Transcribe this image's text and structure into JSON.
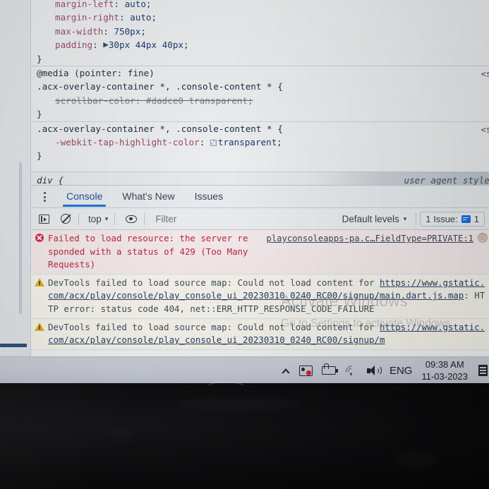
{
  "styles_pane": {
    "rules": [
      {
        "id": "rule-partial-top",
        "lines": [
          {
            "indent": 1,
            "prop": "margin-left",
            "value": "auto;"
          },
          {
            "indent": 1,
            "prop": "margin-right",
            "value": "auto;"
          },
          {
            "indent": 1,
            "prop": "max-width",
            "value": "750px;"
          },
          {
            "indent": 1,
            "prop": "padding",
            "value": "30px 44px 40px;",
            "expander": "▶"
          },
          {
            "indent": 0,
            "punc": "}"
          }
        ],
        "origin": ""
      },
      {
        "id": "rule-media-scrollbar",
        "atrule": "@media (pointer: fine)",
        "selector": ".acx-overlay-container *, .console-content * {",
        "origin": "<sty",
        "lines": [
          {
            "indent": 1,
            "prop": "scrollbar-color",
            "value": "#dadce0 transparent;",
            "struck": true
          },
          {
            "indent": 0,
            "punc": "}"
          }
        ]
      },
      {
        "id": "rule-tap-highlight",
        "selector": ".acx-overlay-container *, .console-content * {",
        "origin": "<sty",
        "lines": [
          {
            "indent": 1,
            "prop": "-webkit-tap-highlight-color",
            "value": "transparent;",
            "swatch": true
          },
          {
            "indent": 0,
            "punc": "}"
          }
        ]
      }
    ],
    "ua_rule": {
      "selector": "div {",
      "origin": "user agent stylesh"
    }
  },
  "drawer": {
    "kebab_icon": "more-options-icon",
    "tabs": [
      {
        "label": "Console",
        "active": true
      },
      {
        "label": "What's New",
        "active": false
      },
      {
        "label": "Issues",
        "active": false
      }
    ],
    "toolbar": {
      "sidebar_toggle_icon": "console-sidebar-icon",
      "clear_icon": "clear-console-icon",
      "context": "top",
      "context_caret": "▾",
      "eye_icon": "live-expression-icon",
      "filter_placeholder": "Filter",
      "filter_value": "",
      "levels_label": "Default levels",
      "levels_caret": "▾",
      "issues_label": "1 Issue:",
      "issues_count": "1",
      "issues_icon": "issue-info-icon"
    },
    "messages": [
      {
        "type": "error",
        "icon": "error-icon",
        "text": "Failed to load resource: the server responded with a status of 429 (Too Many Requests)",
        "source": "playconsoleapps-pa.c…FieldType=PRIVATE:1",
        "source_badge": "ⓘ"
      },
      {
        "type": "warning",
        "icon": "warning-icon",
        "text_prefix": "DevTools failed to load source map: Could not load content for ",
        "link": "https://www.gstatic.com/acx/play/console/play_console_ui_20230310_0240_RC00/signup/main.dart.js.map",
        "text_suffix": ": HTTP error: status code 404, net::ERR_HTTP_RESPONSE_CODE_FAILURE"
      },
      {
        "type": "warning",
        "icon": "warning-icon",
        "text_prefix": "DevTools failed to load source map: Could not load content for ",
        "link": "https://www.gstatic.com/acx/play/console/play_console_ui_20230310_0240_RC00/signup/m",
        "text_suffix": ""
      }
    ]
  },
  "watermark": {
    "title": "Activate Windows",
    "subtitle": "Go to Settings to activate Windows."
  },
  "taskbar": {
    "tray": [
      {
        "name": "show-hidden-icons",
        "label": ""
      },
      {
        "name": "onedrive-icon",
        "label": ""
      },
      {
        "name": "battery-icon",
        "label": ""
      },
      {
        "name": "wifi-icon",
        "label": ""
      },
      {
        "name": "volume-icon",
        "label": ""
      }
    ],
    "language": "ENG",
    "time": "09:38 AM",
    "date": "11-03-2023",
    "notifications_icon": "action-center-icon"
  },
  "colors": {
    "accent_blue": "#1a73e8",
    "error_red": "#c0283c",
    "warn_yellow": "#e8b628",
    "css_property": "#a04a6e",
    "css_value": "#1f3a70",
    "taskbar_bg": "#cfd3dd"
  }
}
